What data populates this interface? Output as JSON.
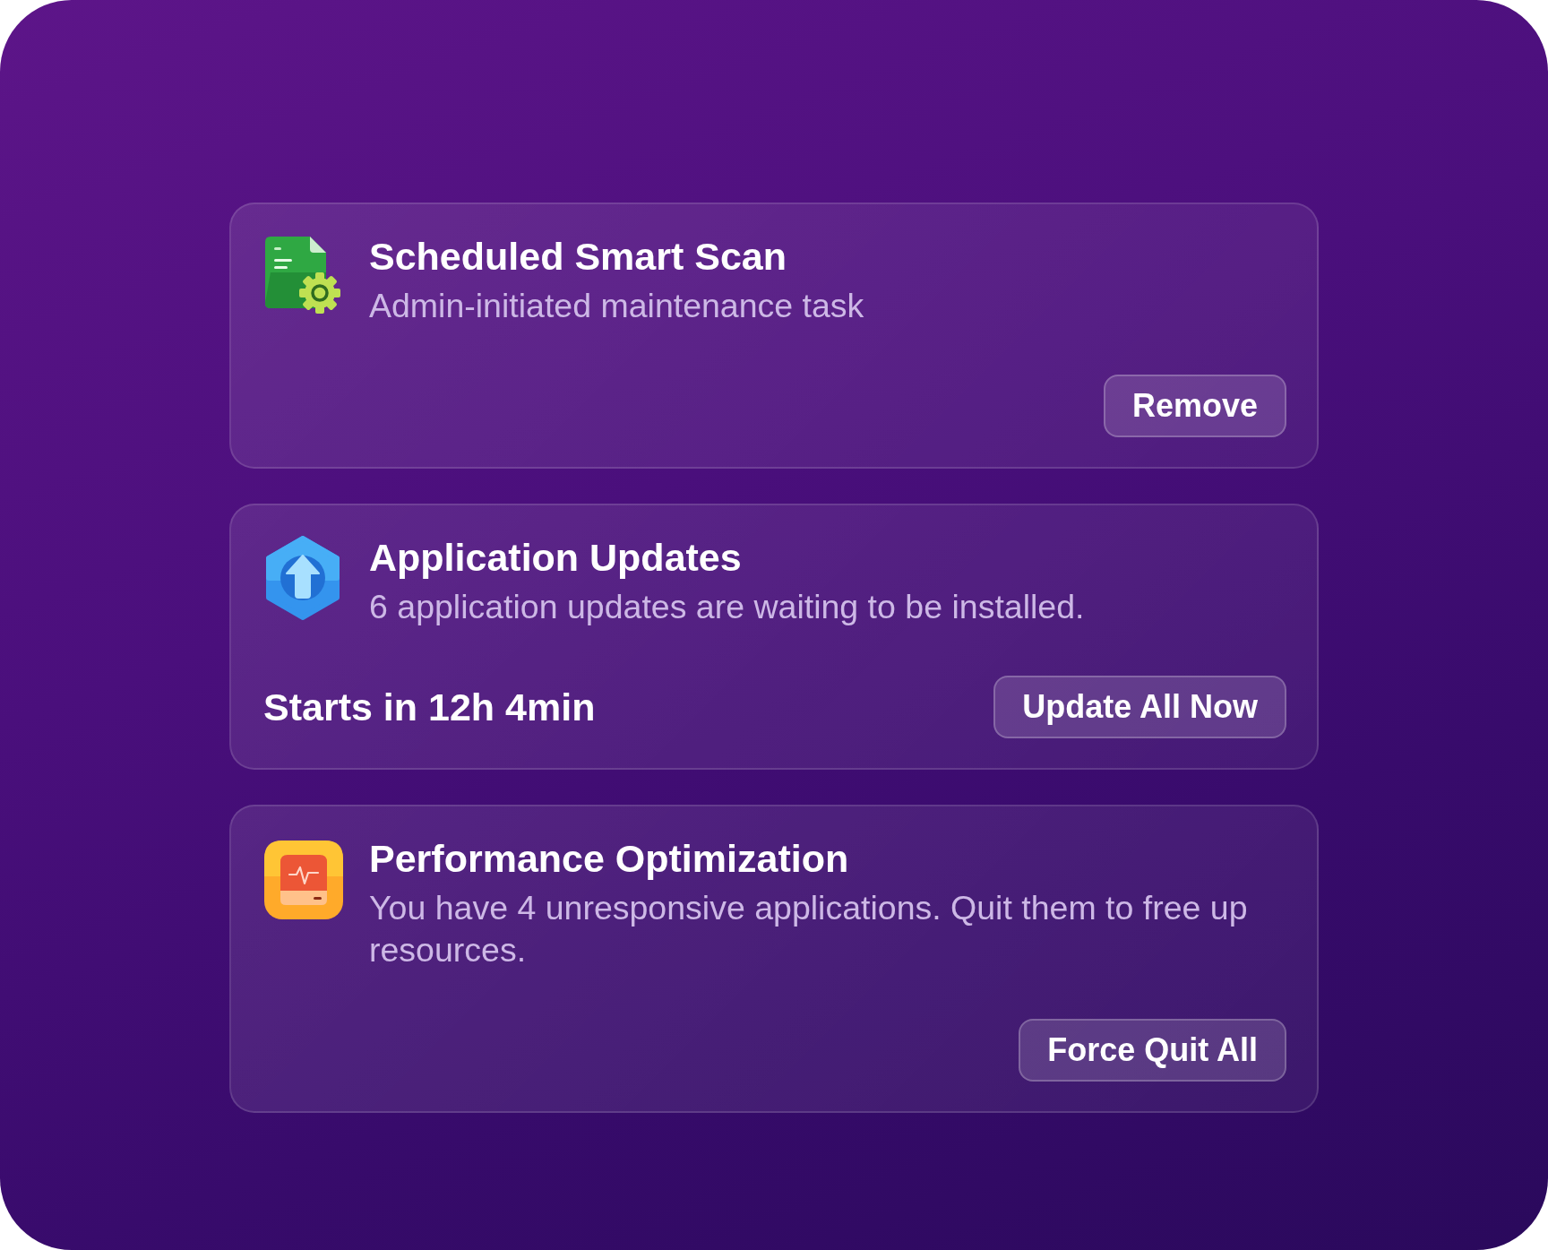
{
  "cards": [
    {
      "title": "Scheduled Smart Scan",
      "description": "Admin-initiated maintenance task",
      "button": "Remove"
    },
    {
      "title": "Application Updates",
      "description": "6 application updates are waiting to be installed.",
      "countdown": "Starts in 12h 4min",
      "button": "Update All Now"
    },
    {
      "title": "Performance Optimization",
      "description": "You have 4 unresponsive applications. Quit them to free up resources.",
      "button": "Force Quit All"
    }
  ]
}
